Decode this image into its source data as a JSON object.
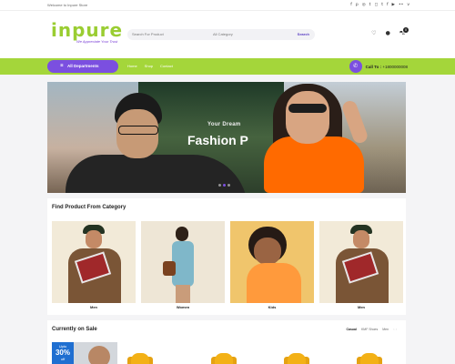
{
  "topbar": {
    "welcome": "Welcome to Inpure Store",
    "social_icons": [
      "facebook-icon",
      "pinterest-icon",
      "dribbble-icon",
      "twitter-icon",
      "instagram-icon",
      "tumblr-icon",
      "facebook-icon",
      "youtube-icon",
      "flickr-icon",
      "vimeo-icon"
    ]
  },
  "header": {
    "logo_text": "inpure",
    "logo_tagline": "We Appreciate Your Trust",
    "search": {
      "placeholder": "Search For Product",
      "category": "All Category",
      "button": "Search"
    },
    "cart_count": "0"
  },
  "nav": {
    "departments_label": "All Departments",
    "links": [
      "Home",
      "Shop",
      "Contact"
    ],
    "call_label": "Call To :",
    "phone": "+1800000008"
  },
  "hero": {
    "kicker": "Your Dream",
    "headline": "Fashion P"
  },
  "categories": {
    "title": "Find Product From Category",
    "items": [
      {
        "label": "Men"
      },
      {
        "label": "Women"
      },
      {
        "label": "Kids"
      },
      {
        "label": "Men"
      }
    ]
  },
  "sale": {
    "title": "Currently on Sale",
    "tabs": [
      "Casual",
      "KMF Shoes",
      "Men"
    ],
    "promo": {
      "upto": "Upto",
      "percent": "30%",
      "off": "off"
    }
  },
  "colors": {
    "brand_green": "#a4d63a",
    "brand_purple": "#7b4fe0"
  }
}
